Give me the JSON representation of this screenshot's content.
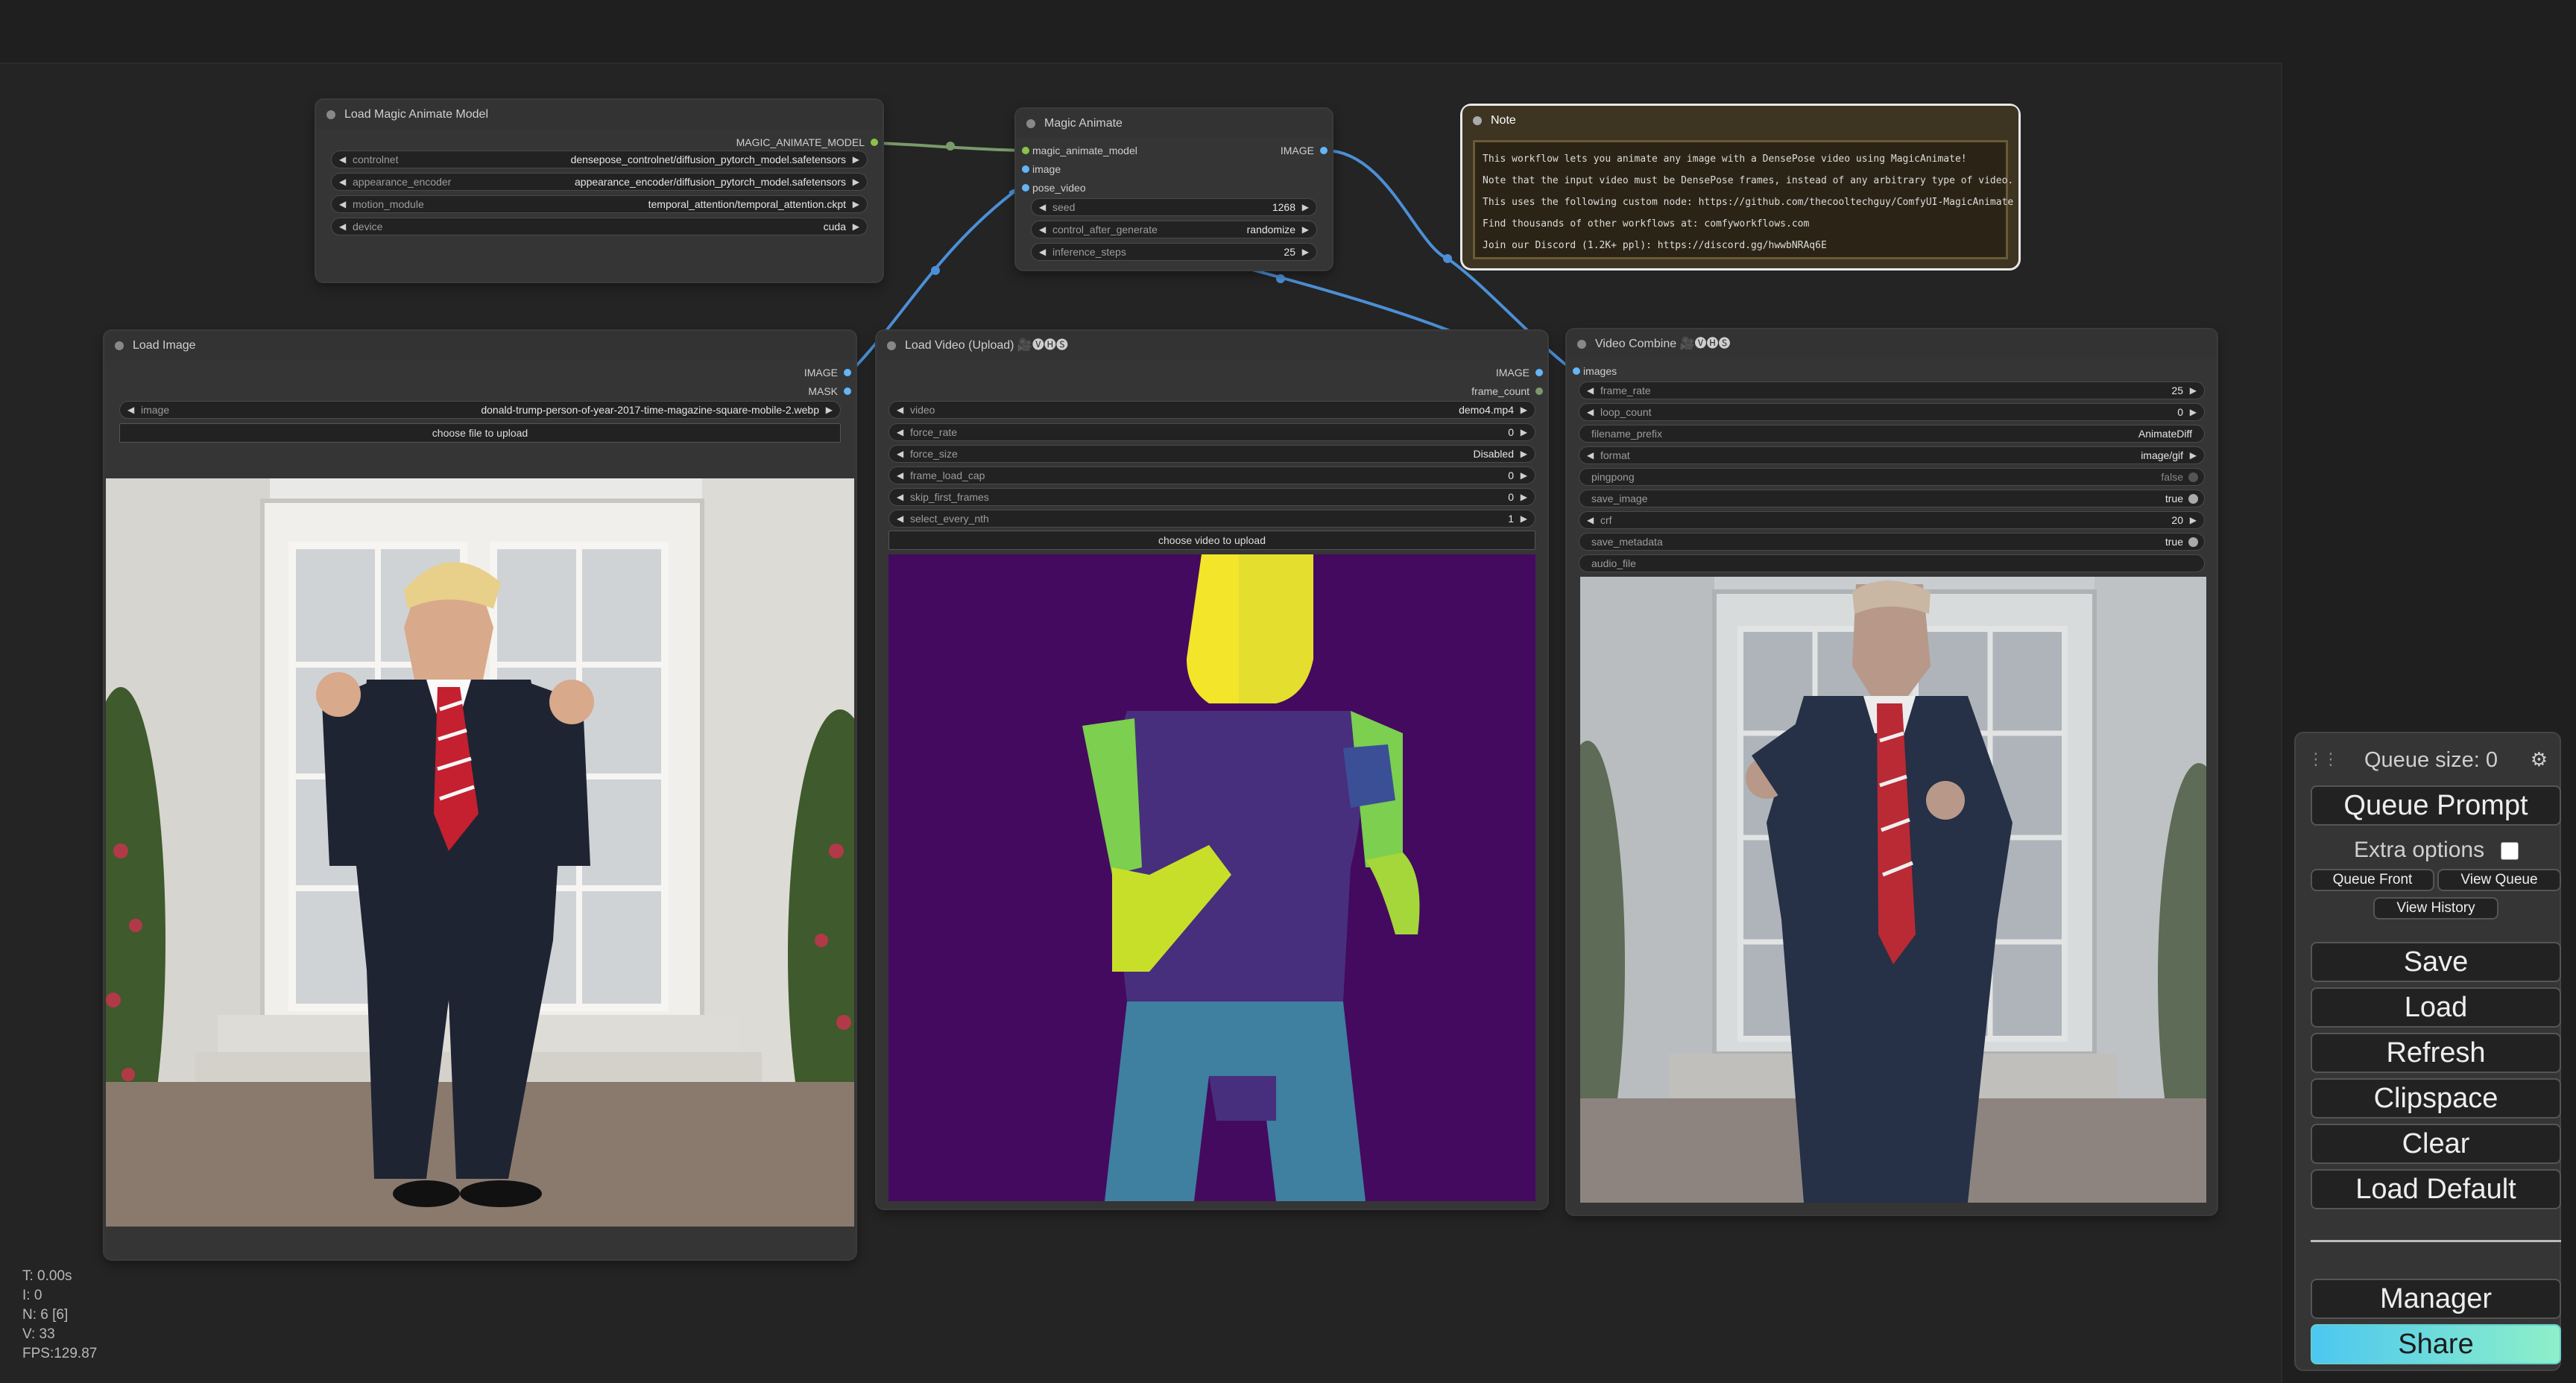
{
  "nodes": {
    "load_model": {
      "title": "Load Magic Animate Model",
      "output": "MAGIC_ANIMATE_MODEL",
      "widgets": [
        {
          "label": "controlnet",
          "value": "densepose_controlnet/diffusion_pytorch_model.safetensors"
        },
        {
          "label": "appearance_encoder",
          "value": "appearance_encoder/diffusion_pytorch_model.safetensors"
        },
        {
          "label": "motion_module",
          "value": "temporal_attention/temporal_attention.ckpt"
        },
        {
          "label": "device",
          "value": "cuda"
        }
      ]
    },
    "magic_animate": {
      "title": "Magic Animate",
      "inputs": [
        "magic_animate_model",
        "image",
        "pose_video"
      ],
      "output": "IMAGE",
      "widgets": [
        {
          "label": "seed",
          "value": "1268"
        },
        {
          "label": "control_after_generate",
          "value": "randomize"
        },
        {
          "label": "inference_steps",
          "value": "25"
        }
      ]
    },
    "note": {
      "title": "Note",
      "lines": [
        "This workflow lets you animate any image with a DensePose video using MagicAnimate!",
        "Note that the input video must be DensePose frames, instead of any arbitrary type of video.",
        "This uses the following custom node: https://github.com/thecooltechguy/ComfyUI-MagicAnimate",
        "Find thousands of other workflows at: comfyworkflows.com",
        "Join our Discord (1.2K+ ppl): https://discord.gg/hwwbNRAq6E"
      ]
    },
    "load_image": {
      "title": "Load Image",
      "outputs": [
        "IMAGE",
        "MASK"
      ],
      "image_widget": {
        "label": "image",
        "value": "donald-trump-person-of-year-2017-time-magazine-square-mobile-2.webp"
      },
      "upload_label": "choose file to upload"
    },
    "load_video": {
      "title": "Load Video (Upload) 🎥🅥🅗🅢",
      "outputs": [
        "IMAGE",
        "frame_count"
      ],
      "widgets": [
        {
          "label": "video",
          "value": "demo4.mp4"
        },
        {
          "label": "force_rate",
          "value": "0"
        },
        {
          "label": "force_size",
          "value": "Disabled"
        },
        {
          "label": "frame_load_cap",
          "value": "0"
        },
        {
          "label": "skip_first_frames",
          "value": "0"
        },
        {
          "label": "select_every_nth",
          "value": "1"
        }
      ],
      "upload_label": "choose video to upload"
    },
    "video_combine": {
      "title": "Video Combine 🎥🅥🅗🅢",
      "input": "images",
      "widgets": [
        {
          "label": "frame_rate",
          "value": "25",
          "kind": "arrows"
        },
        {
          "label": "loop_count",
          "value": "0",
          "kind": "arrows"
        },
        {
          "label": "filename_prefix",
          "value": "AnimateDiff",
          "kind": "text"
        },
        {
          "label": "format",
          "value": "image/gif",
          "kind": "arrows"
        },
        {
          "label": "pingpong",
          "value": "false",
          "kind": "toggle-off"
        },
        {
          "label": "save_image",
          "value": "true",
          "kind": "toggle-on"
        },
        {
          "label": "crf",
          "value": "20",
          "kind": "arrows"
        },
        {
          "label": "save_metadata",
          "value": "true",
          "kind": "toggle-on"
        },
        {
          "label": "audio_file",
          "value": "",
          "kind": "text"
        }
      ]
    }
  },
  "stats": [
    "T: 0.00s",
    "I: 0",
    "N: 6 [6]",
    "V: 33",
    "FPS:129.87"
  ],
  "menu": {
    "queue_size": "Queue size: 0",
    "queue_prompt": "Queue Prompt",
    "extra_options": "Extra options",
    "queue_front": "Queue Front",
    "view_queue": "View Queue",
    "view_history": "View History",
    "save": "Save",
    "load": "Load",
    "refresh": "Refresh",
    "clipspace": "Clipspace",
    "clear": "Clear",
    "load_default": "Load Default",
    "manager": "Manager",
    "share": "Share"
  },
  "colors": {
    "link_blue": "#4c8fd6",
    "link_green": "#7a9a6a",
    "pin_image": "#64b5f6",
    "pin_model": "#8bc34a",
    "densepose_bg": "#440a5f",
    "share_gradient": "#7ee0f0"
  }
}
